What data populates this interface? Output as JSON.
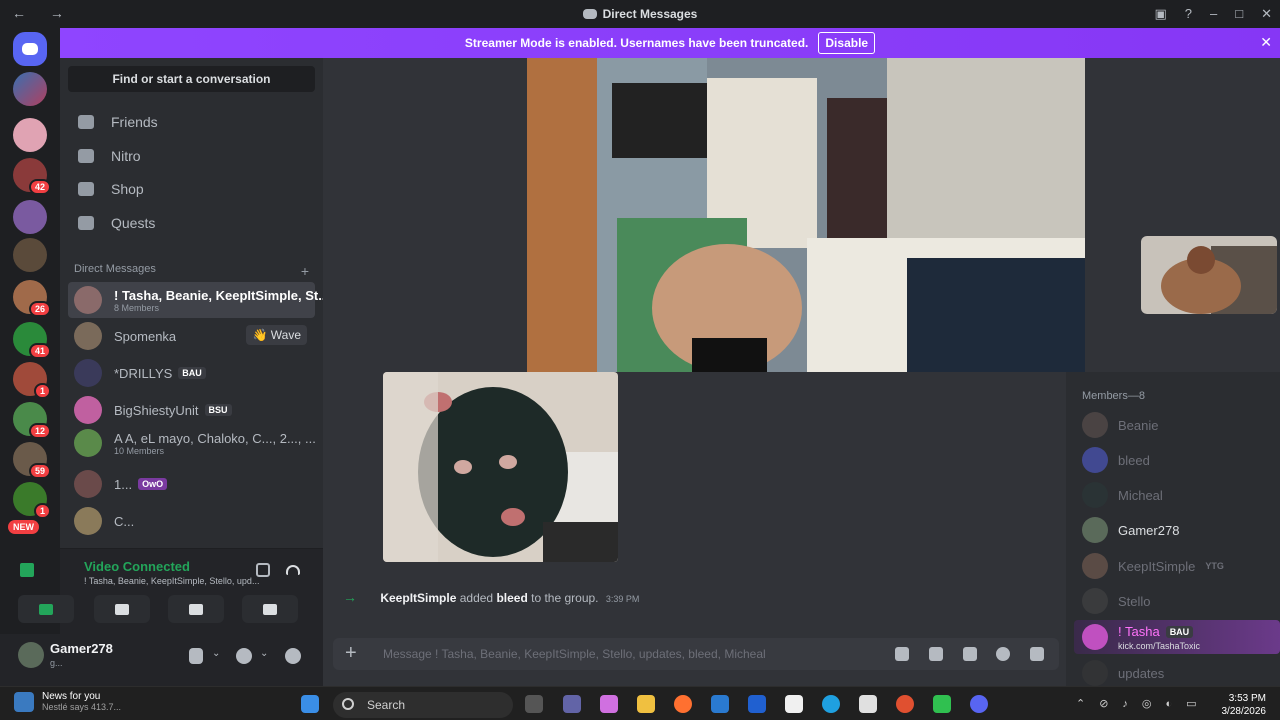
{
  "window": {
    "title": "Direct Messages"
  },
  "banner": {
    "text": "Streamer Mode is enabled. Usernames have been truncated.",
    "button": "Disable"
  },
  "rail": {
    "badges": [
      {
        "count": "42"
      },
      {
        "count": "26"
      },
      {
        "count": "41"
      },
      {
        "count": "1"
      },
      {
        "count": "12"
      },
      {
        "count": "59"
      },
      {
        "count": "1"
      }
    ],
    "new_label": "NEW"
  },
  "sidebar": {
    "find": "Find or start a conversation",
    "nav": [
      {
        "label": "Friends",
        "icon": "friends-icon"
      },
      {
        "label": "Nitro",
        "icon": "nitro-icon"
      },
      {
        "label": "Shop",
        "icon": "shop-icon"
      },
      {
        "label": "Quests",
        "icon": "quests-icon"
      }
    ],
    "dm_header": "Direct Messages",
    "dms": [
      {
        "name": "! Tasha, Beanie, KeepItSimple, St...",
        "sub": "8 Members"
      },
      {
        "name": "Spomenka",
        "action": "Wave"
      },
      {
        "name": "*DRILLYS",
        "tag": "BAU"
      },
      {
        "name": "BigShiestyUnit",
        "tag": "BSU"
      },
      {
        "name": "A A, eL mayo, Chaloko, C..., 2..., ...",
        "sub": "10 Members"
      },
      {
        "name": "1...",
        "tag": "OwO"
      },
      {
        "name": "C..."
      }
    ]
  },
  "voice": {
    "status": "Video Connected",
    "rooms": "! Tasha, Beanie, KeepItSimple, Stello, upd..."
  },
  "user": {
    "name": "Gamer278",
    "status": "g..."
  },
  "chat": {
    "system_actor": "KeepItSimple",
    "system_verb": "added",
    "system_target": "bleed",
    "system_suffix": "to the group.",
    "system_time": "3:39 PM",
    "placeholder": "Message ! Tasha, Beanie, KeepItSimple, Stello, updates, bleed, Micheal"
  },
  "members": {
    "header": "Members—8",
    "list": [
      {
        "name": "Beanie",
        "online": false
      },
      {
        "name": "bleed",
        "online": false
      },
      {
        "name": "Micheal",
        "online": false
      },
      {
        "name": "Gamer278",
        "online": true
      },
      {
        "name": "KeepItSimple",
        "online": false,
        "tag": "YTG"
      },
      {
        "name": "Stello",
        "online": false
      },
      {
        "name": "! Tasha",
        "online": true,
        "tag": "BAU",
        "status": "kick.com/TashaToxic"
      },
      {
        "name": "updates",
        "online": false
      }
    ]
  },
  "taskbar": {
    "news_title": "News for you",
    "news_sub": "Nestlé says 413.7...",
    "search": "Search",
    "time": "3:53 PM",
    "date": "3/28/2026"
  },
  "colors": {
    "brand": "#5865f2",
    "banner": "#8a3cff",
    "green": "#23a55a",
    "red": "#f23f42"
  }
}
